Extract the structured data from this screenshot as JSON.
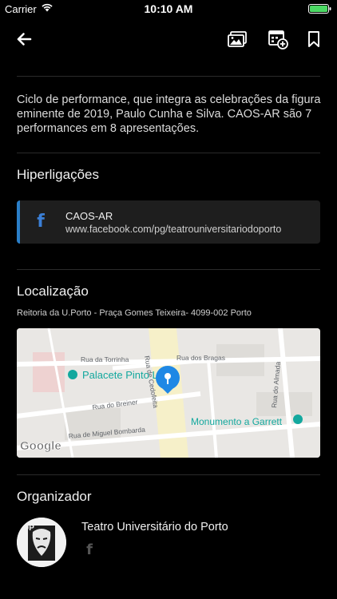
{
  "status_bar": {
    "carrier": "Carrier",
    "time": "10:10 AM",
    "battery_color": "#4cd964"
  },
  "nav": {
    "back_icon": "arrow-left-icon",
    "gallery_icon": "gallery-icon",
    "calendar_icon": "calendar-add-icon",
    "bookmark_icon": "bookmark-icon"
  },
  "event": {
    "description": "Ciclo de performance, que integra as celebrações da figura eminente de 2019, Paulo Cunha e Silva. CAOS-AR são 7 performances em 8 apresentações."
  },
  "links_section": {
    "title": "Hiperligações",
    "items": [
      {
        "icon": "facebook-icon",
        "title": "CAOS-AR",
        "url": "www.facebook.com/pg/teatrouniversitariodoporto"
      }
    ]
  },
  "location_section": {
    "title": "Localização",
    "address": "Reitoria da U.Porto - Praça Gomes Teixeira- 4099-002 Porto",
    "map": {
      "streets": [
        "Rua da Torrinha",
        "Rua dos Bragas",
        "Rua do Breiner",
        "Rua de Miguel Bombarda",
        "Rua do Almada",
        "Rua de Cedofeita"
      ],
      "places": [
        "Palacete Pinto Le",
        "Monumento a Garrett"
      ],
      "logo": "Google"
    }
  },
  "organizer_section": {
    "title": "Organizador",
    "name": "Teatro Universitário do Porto",
    "avatar_text": "UP",
    "social_icon": "facebook-icon"
  },
  "colors": {
    "background": "#000000",
    "card": "#1e1e1e",
    "accent": "#2a7fc9",
    "marker": "#1f88e5"
  }
}
